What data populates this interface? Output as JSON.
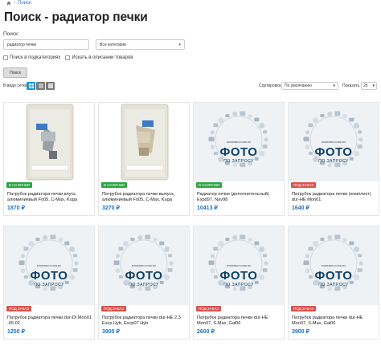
{
  "breadcrumb": {
    "items": [
      "Поиск"
    ]
  },
  "page": {
    "title": "Поиск - радиатор печки"
  },
  "search": {
    "label": "Поиск:",
    "value": "радиатор печки",
    "category": "Все категории",
    "subcategories_label": "Поиск в подкатегориях",
    "descriptions_label": "Искать в описании товаров",
    "button_label": "Поиск"
  },
  "toolbar": {
    "view_label": "В виде сетки",
    "sort_label": "Сортировка",
    "sort_value": "По умолчанию",
    "show_label": "Показать",
    "show_value": "25"
  },
  "placeholder": {
    "site": "DOMKRRO-FORD.RU",
    "foto": "ФОТО",
    "zapros": "ПО ЗАПРОСУ"
  },
  "colors": {
    "accent": "#2196d3",
    "price": "#1a73c7",
    "in_stock": "#2ea443",
    "on_order": "#d9534f"
  },
  "products": [
    {
      "image": "photo",
      "badge": "В НАЛИЧИИ",
      "badge_type": "green",
      "name": "Патрубок радиатора печки впуск, алюминиевый Fo05, C-Max, Kuga",
      "price": "1870 ₽"
    },
    {
      "image": "photo",
      "badge": "В НАЛИЧИИ",
      "badge_type": "green",
      "name": "Патрубок радиатора печки выпуск, алюминиевый Fo05, C-Max, Kuga",
      "price": "3270 ₽"
    },
    {
      "image": "placeholder",
      "badge": "В НАЛИЧИИ",
      "badge_type": "green",
      "name": "Радиатор печки (дополнительный) Expd97, Nav98",
      "price": "10413 ₽"
    },
    {
      "image": "placeholder",
      "badge": "ПОД ЗАКАЗ",
      "badge_type": "red",
      "name": "Патрубок радиатора печки (комплект) dur-HE Mon01",
      "price": "1640 ₽"
    },
    {
      "image": "placeholder",
      "badge": "ПОД ЗАКАЗ",
      "badge_type": "red",
      "name": "Патрубок радиатора печки dur-DI Mon01 -05.02",
      "price": "1250 ₽"
    },
    {
      "image": "placeholder",
      "badge": "ПОД ЗАКАЗ",
      "badge_type": "red",
      "name": "Патрубок радиатора печки dur-HE 2.3 Escp Hyb, Escp07 Hyb",
      "price": "3900 ₽"
    },
    {
      "image": "placeholder",
      "badge": "ПОД ЗАКАЗ",
      "badge_type": "red",
      "name": "Патрубок радиатора печки dur-HE Mon07, S-Max, Gal06",
      "price": "2600 ₽"
    },
    {
      "image": "placeholder",
      "badge": "ПОД ЗАКАЗ",
      "badge_type": "red",
      "name": "Патрубок радиатора печки dur-HE Mon07, S-Max, Gal06",
      "price": "3900 ₽"
    }
  ]
}
